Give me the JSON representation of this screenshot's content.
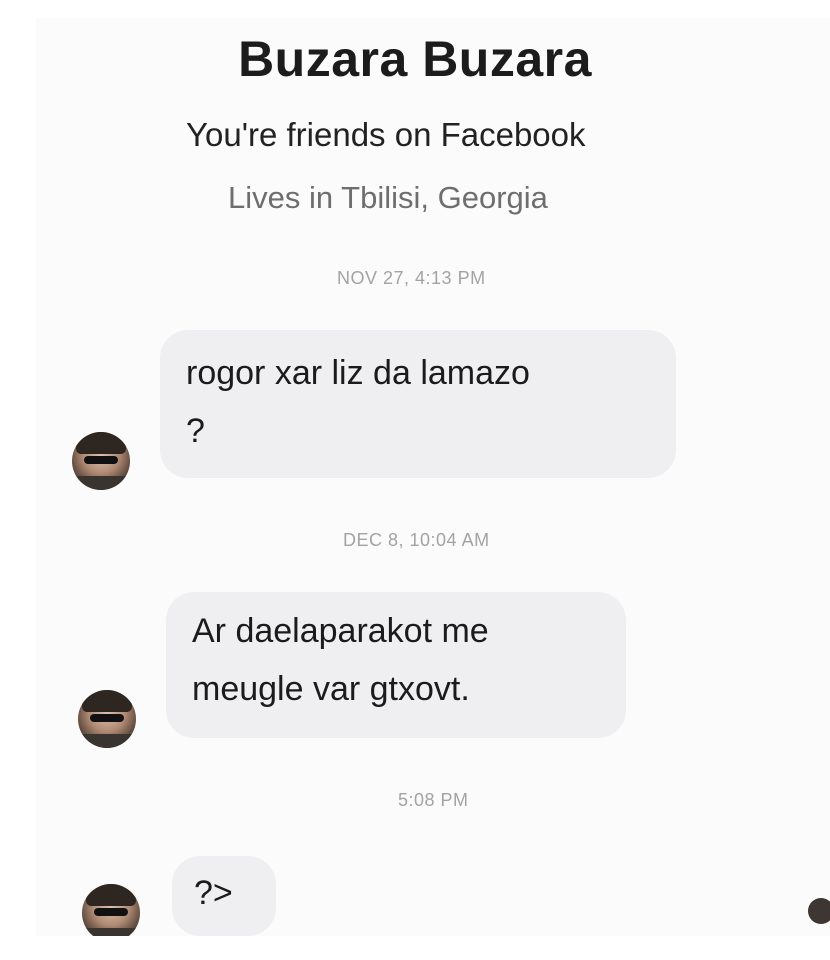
{
  "contact": {
    "name": "Buzara Buzara",
    "friendship": "You're friends on Facebook",
    "location": "Lives in Tbilisi, Georgia"
  },
  "messages": [
    {
      "timestamp": "NOV 27, 4:13 PM",
      "lines": [
        "rogor xar liz da lamazo",
        "?"
      ]
    },
    {
      "timestamp": "DEC 8, 10:04 AM",
      "lines": [
        "Ar daelaparakot me",
        "meugle var gtxovt."
      ]
    },
    {
      "timestamp": "5:08 PM",
      "lines": [
        "?>"
      ]
    }
  ],
  "icons": {
    "avatar": "contact-avatar-photo"
  },
  "colors": {
    "bubble": "#efeff1",
    "timestamp": "#a3a3a3",
    "background": "#fbfbfb"
  }
}
